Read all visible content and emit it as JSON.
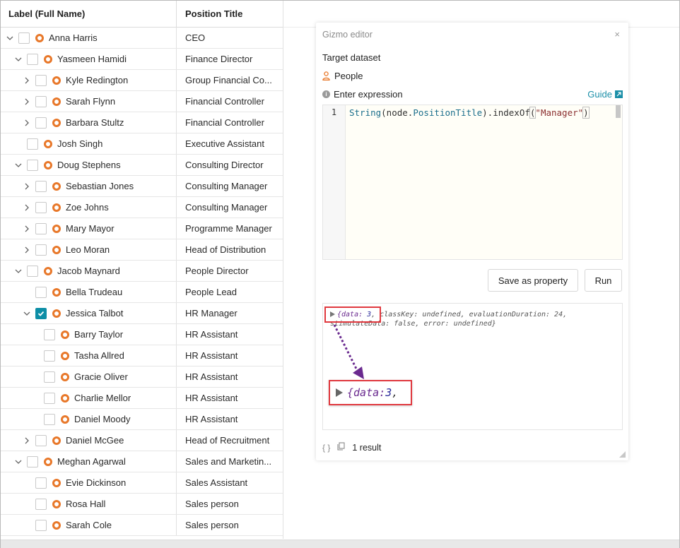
{
  "grid": {
    "headers": {
      "label": "Label (Full Name)",
      "position": "Position Title"
    },
    "rows": [
      {
        "name": "Anna Harris",
        "title": "CEO",
        "indent": 0,
        "expanded": true,
        "hasChildren": true,
        "checked": false
      },
      {
        "name": "Yasmeen Hamidi",
        "title": "Finance Director",
        "indent": 1,
        "expanded": true,
        "hasChildren": true,
        "checked": false
      },
      {
        "name": "Kyle Redington",
        "title": "Group Financial Co...",
        "indent": 2,
        "expanded": false,
        "hasChildren": true,
        "checked": false
      },
      {
        "name": "Sarah Flynn",
        "title": "Financial Controller",
        "indent": 2,
        "expanded": false,
        "hasChildren": true,
        "checked": false
      },
      {
        "name": "Barbara Stultz",
        "title": "Financial Controller",
        "indent": 2,
        "expanded": false,
        "hasChildren": true,
        "checked": false
      },
      {
        "name": "Josh Singh",
        "title": "Executive Assistant",
        "indent": 1,
        "expanded": false,
        "hasChildren": false,
        "checked": false
      },
      {
        "name": "Doug Stephens",
        "title": "Consulting Director",
        "indent": 1,
        "expanded": true,
        "hasChildren": true,
        "checked": false
      },
      {
        "name": "Sebastian Jones",
        "title": "Consulting Manager",
        "indent": 2,
        "expanded": false,
        "hasChildren": true,
        "checked": false
      },
      {
        "name": "Zoe Johns",
        "title": "Consulting Manager",
        "indent": 2,
        "expanded": false,
        "hasChildren": true,
        "checked": false
      },
      {
        "name": "Mary Mayor",
        "title": "Programme Manager",
        "indent": 2,
        "expanded": false,
        "hasChildren": true,
        "checked": false
      },
      {
        "name": "Leo Moran",
        "title": "Head of Distribution",
        "indent": 2,
        "expanded": false,
        "hasChildren": true,
        "checked": false
      },
      {
        "name": "Jacob Maynard",
        "title": "People Director",
        "indent": 1,
        "expanded": true,
        "hasChildren": true,
        "checked": false
      },
      {
        "name": "Bella Trudeau",
        "title": "People Lead",
        "indent": 2,
        "expanded": false,
        "hasChildren": false,
        "checked": false
      },
      {
        "name": "Jessica Talbot",
        "title": "HR Manager",
        "indent": 2,
        "expanded": true,
        "hasChildren": true,
        "checked": true
      },
      {
        "name": "Barry Taylor",
        "title": "HR Assistant",
        "indent": 3,
        "expanded": false,
        "hasChildren": false,
        "checked": false
      },
      {
        "name": "Tasha Allred",
        "title": "HR Assistant",
        "indent": 3,
        "expanded": false,
        "hasChildren": false,
        "checked": false
      },
      {
        "name": "Gracie Oliver",
        "title": "HR Assistant",
        "indent": 3,
        "expanded": false,
        "hasChildren": false,
        "checked": false
      },
      {
        "name": "Charlie Mellor",
        "title": "HR Assistant",
        "indent": 3,
        "expanded": false,
        "hasChildren": false,
        "checked": false
      },
      {
        "name": "Daniel Moody",
        "title": "HR Assistant",
        "indent": 3,
        "expanded": false,
        "hasChildren": false,
        "checked": false
      },
      {
        "name": "Daniel McGee",
        "title": "Head of Recruitment",
        "indent": 2,
        "expanded": false,
        "hasChildren": true,
        "checked": false
      },
      {
        "name": "Meghan Agarwal",
        "title": "Sales and Marketin...",
        "indent": 1,
        "expanded": true,
        "hasChildren": true,
        "checked": false
      },
      {
        "name": "Evie Dickinson",
        "title": "Sales Assistant",
        "indent": 2,
        "expanded": false,
        "hasChildren": false,
        "checked": false
      },
      {
        "name": "Rosa Hall",
        "title": "Sales person",
        "indent": 2,
        "expanded": false,
        "hasChildren": false,
        "checked": false
      },
      {
        "name": "Sarah Cole",
        "title": "Sales person",
        "indent": 2,
        "expanded": false,
        "hasChildren": false,
        "checked": false
      }
    ]
  },
  "gizmo": {
    "title": "Gizmo editor",
    "close": "×",
    "target_label": "Target dataset",
    "dataset": "People",
    "expression_label": "Enter expression",
    "guide_label": "Guide",
    "line_number": "1",
    "code": {
      "fn": "String",
      "open": "(node.",
      "prop": "PositionTitle",
      "mid": ").indexOf",
      "paren_open": "(",
      "str": "\"Manager\"",
      "paren_close": ")"
    },
    "save_label": "Save as property",
    "run_label": "Run",
    "output": {
      "line1_k1": "{data:",
      "line1_v1": " 3",
      "line1_rest": ", classKey: undefined, evaluationDuration: 24,",
      "line2": "stimulateData: false, error: undefined}",
      "zoom_k": "{data:",
      "zoom_v": " 3",
      "zoom_tail": ","
    },
    "result_count": "1 result"
  },
  "colors": {
    "accent": "#0d8ea6",
    "node": "#e8782a",
    "highlight": "#e0383e",
    "arrow": "#6a2a8f"
  }
}
